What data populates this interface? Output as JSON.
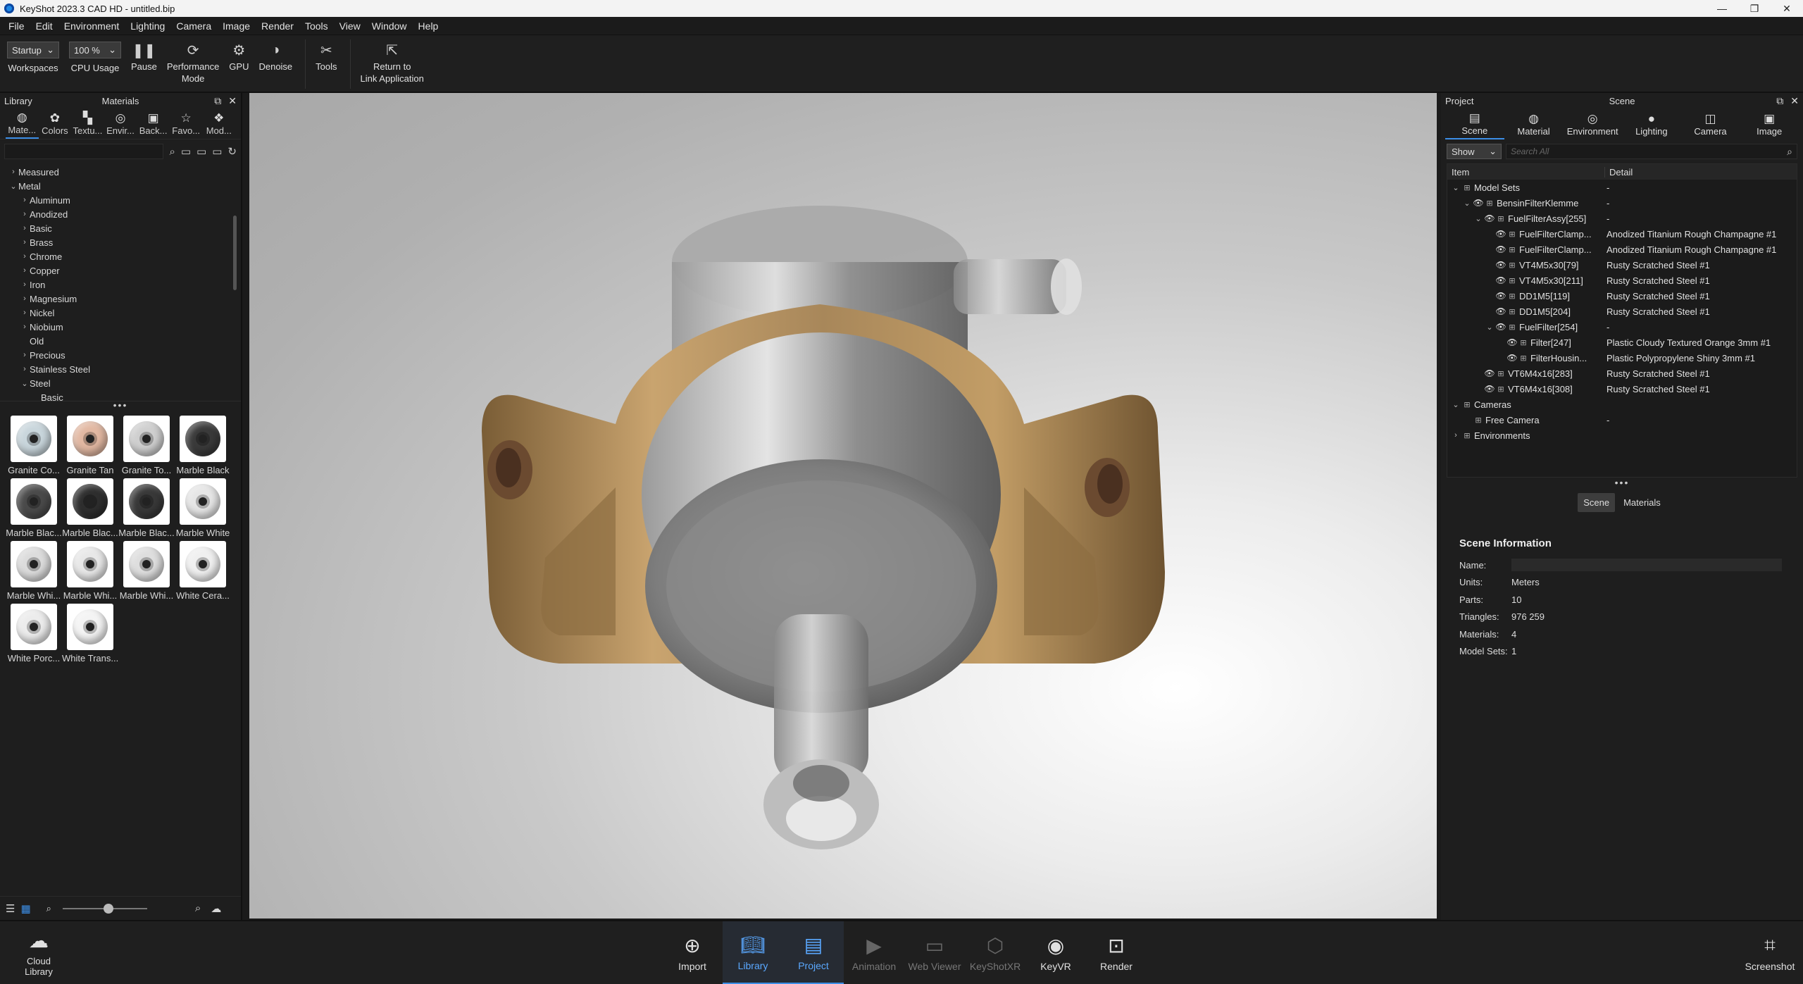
{
  "window": {
    "title": "KeyShot 2023.3 CAD HD  - untitled.bip"
  },
  "menu": [
    "File",
    "Edit",
    "Environment",
    "Lighting",
    "Camera",
    "Image",
    "Render",
    "Tools",
    "View",
    "Window",
    "Help"
  ],
  "toolbar": {
    "workspace_value": "Startup",
    "workspace_label": "Workspaces",
    "cpu_value": "100 %",
    "cpu_label": "CPU Usage",
    "pause": "Pause",
    "performance_line1": "Performance",
    "performance_line2": "Mode",
    "gpu": "GPU",
    "denoise": "Denoise",
    "tools": "Tools",
    "return_line1": "Return to",
    "return_line2": "Link Application"
  },
  "library": {
    "panel_title": "Library",
    "section_title": "Materials",
    "tabs": [
      {
        "label": "Mate...",
        "icon": "material-icon"
      },
      {
        "label": "Colors",
        "icon": "palette-icon"
      },
      {
        "label": "Textu...",
        "icon": "texture-icon"
      },
      {
        "label": "Envir...",
        "icon": "globe-icon"
      },
      {
        "label": "Back...",
        "icon": "image-icon"
      },
      {
        "label": "Favo...",
        "icon": "star-icon"
      },
      {
        "label": "Mod...",
        "icon": "model-icon"
      }
    ],
    "tree": [
      {
        "label": "Measured",
        "level": 1,
        "arrow": "›"
      },
      {
        "label": "Metal",
        "level": 1,
        "arrow": "⌄"
      },
      {
        "label": "Aluminum",
        "level": 2,
        "arrow": "›"
      },
      {
        "label": "Anodized",
        "level": 2,
        "arrow": "›"
      },
      {
        "label": "Basic",
        "level": 2,
        "arrow": "›"
      },
      {
        "label": "Brass",
        "level": 2,
        "arrow": "›"
      },
      {
        "label": "Chrome",
        "level": 2,
        "arrow": "›"
      },
      {
        "label": "Copper",
        "level": 2,
        "arrow": "›"
      },
      {
        "label": "Iron",
        "level": 2,
        "arrow": "›"
      },
      {
        "label": "Magnesium",
        "level": 2,
        "arrow": "›"
      },
      {
        "label": "Nickel",
        "level": 2,
        "arrow": "›"
      },
      {
        "label": "Niobium",
        "level": 2,
        "arrow": "›"
      },
      {
        "label": "Old",
        "level": 2,
        "arrow": ""
      },
      {
        "label": "Precious",
        "level": 2,
        "arrow": "›"
      },
      {
        "label": "Stainless Steel",
        "level": 2,
        "arrow": "›"
      },
      {
        "label": "Steel",
        "level": 2,
        "arrow": "⌄"
      },
      {
        "label": "Basic",
        "level": 3,
        "arrow": ""
      }
    ],
    "thumbnails": [
      {
        "name": "Granite Co...",
        "color": "#c9d6dc"
      },
      {
        "name": "Granite Tan",
        "color": "#e2b8a2"
      },
      {
        "name": "Granite To...",
        "color": "#cfcfcf"
      },
      {
        "name": "Marble Black",
        "color": "#3a3a3a"
      },
      {
        "name": "Marble Blac...",
        "color": "#4a4a4a"
      },
      {
        "name": "Marble Blac...",
        "color": "#2e2e2e"
      },
      {
        "name": "Marble Blac...",
        "color": "#383838"
      },
      {
        "name": "Marble White",
        "color": "#e6e6e6"
      },
      {
        "name": "Marble Whi...",
        "color": "#dcdcdc"
      },
      {
        "name": "Marble Whi...",
        "color": "#e8e8e8"
      },
      {
        "name": "Marble Whi...",
        "color": "#dedede"
      },
      {
        "name": "White Cera...",
        "color": "#f0f0f0"
      },
      {
        "name": "White Porc...",
        "color": "#ececec"
      },
      {
        "name": "White Trans...",
        "color": "#f4f4f4"
      }
    ]
  },
  "project": {
    "panel_title": "Project",
    "section_title": "Scene",
    "tabs": [
      {
        "label": "Scene",
        "icon": "scene-icon"
      },
      {
        "label": "Material",
        "icon": "material-icon"
      },
      {
        "label": "Environment",
        "icon": "globe-icon"
      },
      {
        "label": "Lighting",
        "icon": "bulb-icon"
      },
      {
        "label": "Camera",
        "icon": "camera-icon"
      },
      {
        "label": "Image",
        "icon": "image-icon"
      }
    ],
    "show_value": "Show",
    "search_placeholder": "Search All",
    "col_item": "Item",
    "col_detail": "Detail",
    "rows": [
      {
        "indent": 0,
        "arrow": "⌄",
        "eye": false,
        "item": "Model Sets",
        "detail": "-"
      },
      {
        "indent": 1,
        "arrow": "⌄",
        "eye": true,
        "item": "BensinFilterKlemme",
        "detail": "-"
      },
      {
        "indent": 2,
        "arrow": "⌄",
        "eye": true,
        "item": "FuelFilterAssy[255]",
        "detail": "-"
      },
      {
        "indent": 3,
        "arrow": "",
        "eye": true,
        "item": "FuelFilterClamp...",
        "detail": "Anodized Titanium Rough Champagne #1"
      },
      {
        "indent": 3,
        "arrow": "",
        "eye": true,
        "item": "FuelFilterClamp...",
        "detail": "Anodized Titanium Rough Champagne #1"
      },
      {
        "indent": 3,
        "arrow": "",
        "eye": true,
        "item": "VT4M5x30[79]",
        "detail": "Rusty Scratched Steel #1"
      },
      {
        "indent": 3,
        "arrow": "",
        "eye": true,
        "item": "VT4M5x30[211]",
        "detail": "Rusty Scratched Steel #1"
      },
      {
        "indent": 3,
        "arrow": "",
        "eye": true,
        "item": "DD1M5[119]",
        "detail": "Rusty Scratched Steel #1"
      },
      {
        "indent": 3,
        "arrow": "",
        "eye": true,
        "item": "DD1M5[204]",
        "detail": "Rusty Scratched Steel #1"
      },
      {
        "indent": 3,
        "arrow": "⌄",
        "eye": true,
        "item": "FuelFilter[254]",
        "detail": "-"
      },
      {
        "indent": 4,
        "arrow": "",
        "eye": true,
        "item": "Filter[247]",
        "detail": "Plastic Cloudy Textured Orange 3mm #1"
      },
      {
        "indent": 4,
        "arrow": "",
        "eye": true,
        "item": "FilterHousin...",
        "detail": "Plastic Polypropylene Shiny 3mm #1"
      },
      {
        "indent": 2,
        "arrow": "",
        "eye": true,
        "item": "VT6M4x16[283]",
        "detail": "Rusty Scratched Steel #1"
      },
      {
        "indent": 2,
        "arrow": "",
        "eye": true,
        "item": "VT6M4x16[308]",
        "detail": "Rusty Scratched Steel #1"
      },
      {
        "indent": 0,
        "arrow": "⌄",
        "eye": false,
        "item": "Cameras",
        "detail": ""
      },
      {
        "indent": 1,
        "arrow": "",
        "eye": false,
        "item": "Free Camera",
        "detail": "-"
      },
      {
        "indent": 0,
        "arrow": "›",
        "eye": false,
        "item": "Environments",
        "detail": ""
      }
    ],
    "switch_scene": "Scene",
    "switch_materials": "Materials",
    "info_title": "Scene Information",
    "info": {
      "name_label": "Name:",
      "units_label": "Units:",
      "units": "Meters",
      "parts_label": "Parts:",
      "parts": "10",
      "triangles_label": "Triangles:",
      "triangles": "976 259",
      "materials_label": "Materials:",
      "materials": "4",
      "modelsets_label": "Model Sets:",
      "modelsets": "1"
    }
  },
  "bottom": {
    "cloud_line1": "Cloud",
    "cloud_line2": "Library",
    "import": "Import",
    "library": "Library",
    "project": "Project",
    "animation": "Animation",
    "webviewer": "Web Viewer",
    "keyshotxr": "KeyShotXR",
    "keyvr": "KeyVR",
    "render": "Render",
    "screenshot": "Screenshot"
  },
  "colors": {
    "accent": "#3c8ee6",
    "bronze": "#a8875a"
  }
}
